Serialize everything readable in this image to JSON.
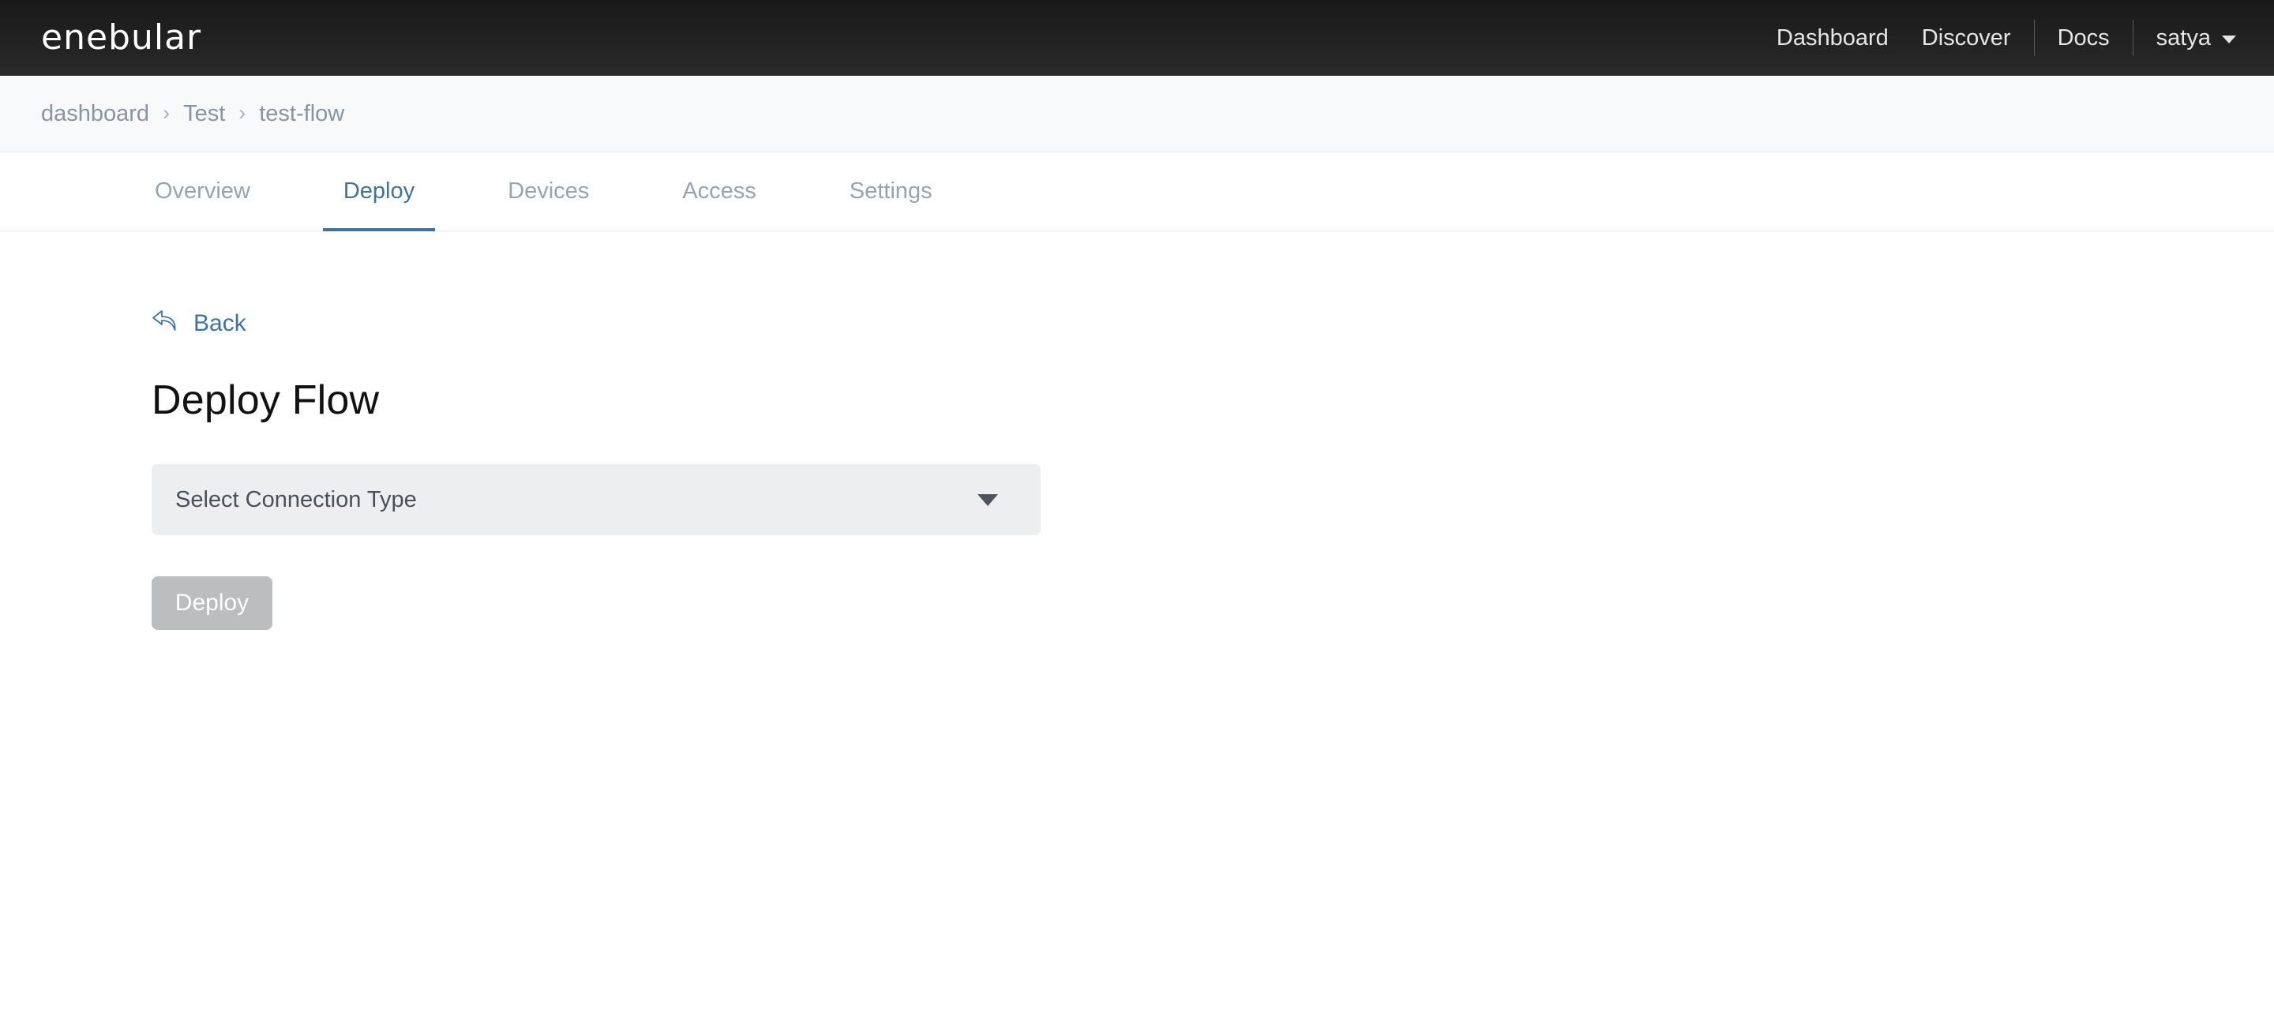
{
  "header": {
    "brand": "enebular",
    "nav": [
      {
        "label": "Dashboard",
        "name": "nav-dashboard"
      },
      {
        "label": "Discover",
        "name": "nav-discover"
      },
      {
        "label": "Docs",
        "name": "nav-docs"
      }
    ],
    "user": {
      "name": "satya",
      "caret_icon": "chevron-down-icon"
    }
  },
  "breadcrumb": {
    "items": [
      {
        "label": "dashboard"
      },
      {
        "label": "Test"
      },
      {
        "label": "test-flow"
      }
    ],
    "separator": "›"
  },
  "tabs": [
    {
      "label": "Overview",
      "active": false
    },
    {
      "label": "Deploy",
      "active": true
    },
    {
      "label": "Devices",
      "active": false
    },
    {
      "label": "Access",
      "active": false
    },
    {
      "label": "Settings",
      "active": false
    }
  ],
  "main": {
    "back": {
      "label": "Back",
      "icon": "reply-arrow-left-icon"
    },
    "title": "Deploy Flow",
    "connection_select": {
      "value": "Select Connection Type",
      "arrow_icon": "triangle-down-icon"
    },
    "deploy_button": {
      "label": "Deploy",
      "disabled": true
    }
  },
  "colors": {
    "header_bg": "#1f1f1f",
    "breadcrumb_bg": "#f7f9fb",
    "accent_blue": "#41719c",
    "link_blue": "#3d74a5",
    "muted_text": "#9aa3ab",
    "select_bg": "#eceef0",
    "button_disabled_bg": "#bcbdbf"
  }
}
